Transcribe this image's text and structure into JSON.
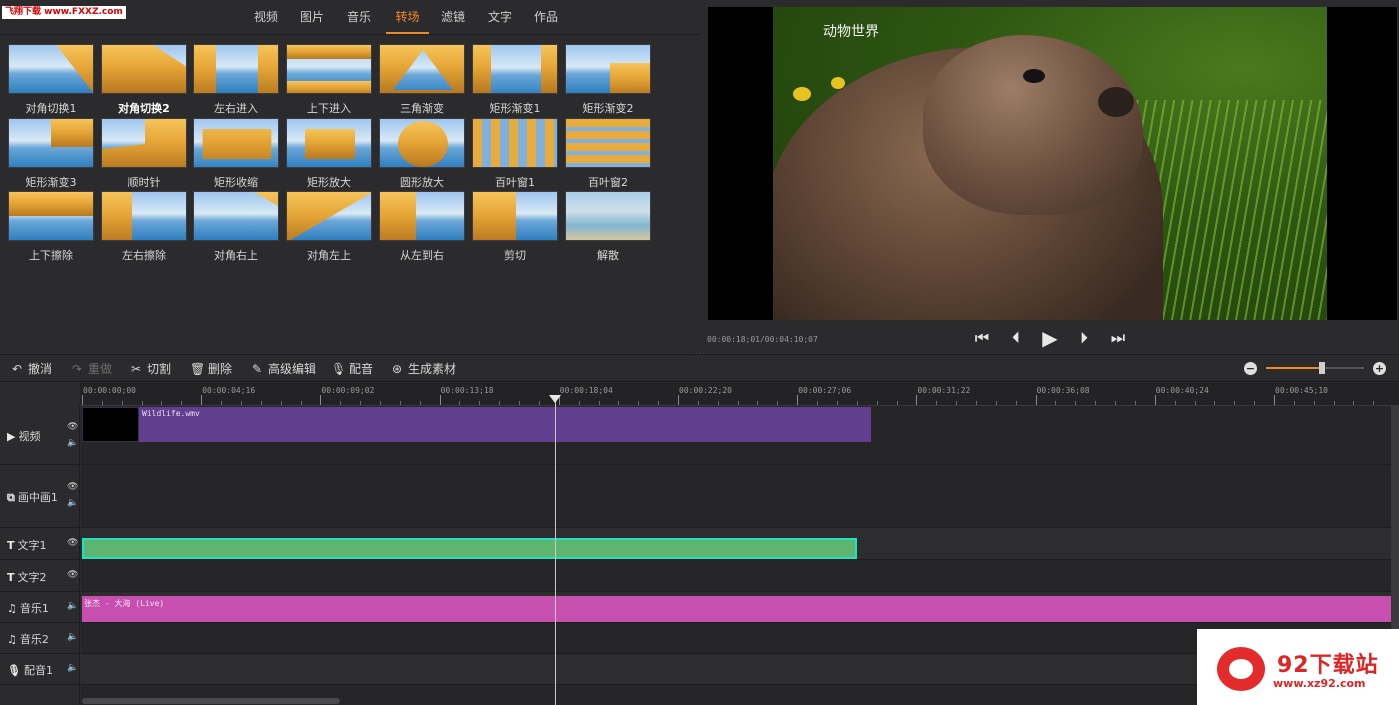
{
  "watermark_top": "飞翔下载 www.FXXZ.com",
  "library": {
    "tabs": [
      "视频",
      "图片",
      "音乐",
      "转场",
      "滤镜",
      "文字",
      "作品"
    ],
    "active_tab": "转场",
    "transitions": [
      "对角切换1",
      "对角切换2",
      "左右进入",
      "上下进入",
      "三角渐变",
      "矩形渐变1",
      "矩形渐变2",
      "矩形渐变3",
      "顺时针",
      "矩形收缩",
      "矩形放大",
      "圆形放大",
      "百叶窗1",
      "百叶窗2",
      "上下擦除",
      "左右擦除",
      "对角右上",
      "对角左上",
      "从左到右",
      "剪切",
      "解散"
    ],
    "selected_transition": "对角切换2"
  },
  "preview": {
    "video_title": "动物世界",
    "timecode": "00:00:18;01/00:04:10;07",
    "buttons": [
      "skip-start-icon",
      "step-back-icon",
      "play-icon",
      "step-forward-icon",
      "skip-end-icon"
    ]
  },
  "toolbar": {
    "undo": "撤消",
    "redo": "重做",
    "cut": "切割",
    "delete": "删除",
    "advanced_edit": "高级编辑",
    "voiceover": "配音",
    "generate_asset": "生成素材",
    "zoom_level": 0.57
  },
  "ruler": {
    "labels": [
      "00:00:00;00",
      "00:00:04;16",
      "00:00:09;02",
      "00:00:13;18",
      "00:00:18;04",
      "00:00:22;20",
      "00:00:27;06",
      "00:00:31;22",
      "00:00:36;08",
      "00:00:40;24",
      "00:00:45;10"
    ]
  },
  "tracks": {
    "video": "视频",
    "pip1": "画中画1",
    "text1": "文字1",
    "text2": "文字2",
    "music1": "音乐1",
    "music2": "音乐2",
    "voice1": "配音1"
  },
  "clips": {
    "video_clip": "Wildlife.wmv",
    "music_clip": "张杰 - 大海 (Live)"
  },
  "site_watermark": {
    "name": "92下载站",
    "url": "www.xz92.com"
  },
  "colors": {
    "accent": "#f08a24",
    "video_clip": "#623f8e",
    "text_clip": "#5db56f",
    "text_clip_border": "#21e0c8",
    "music_clip": "#c64faf"
  }
}
